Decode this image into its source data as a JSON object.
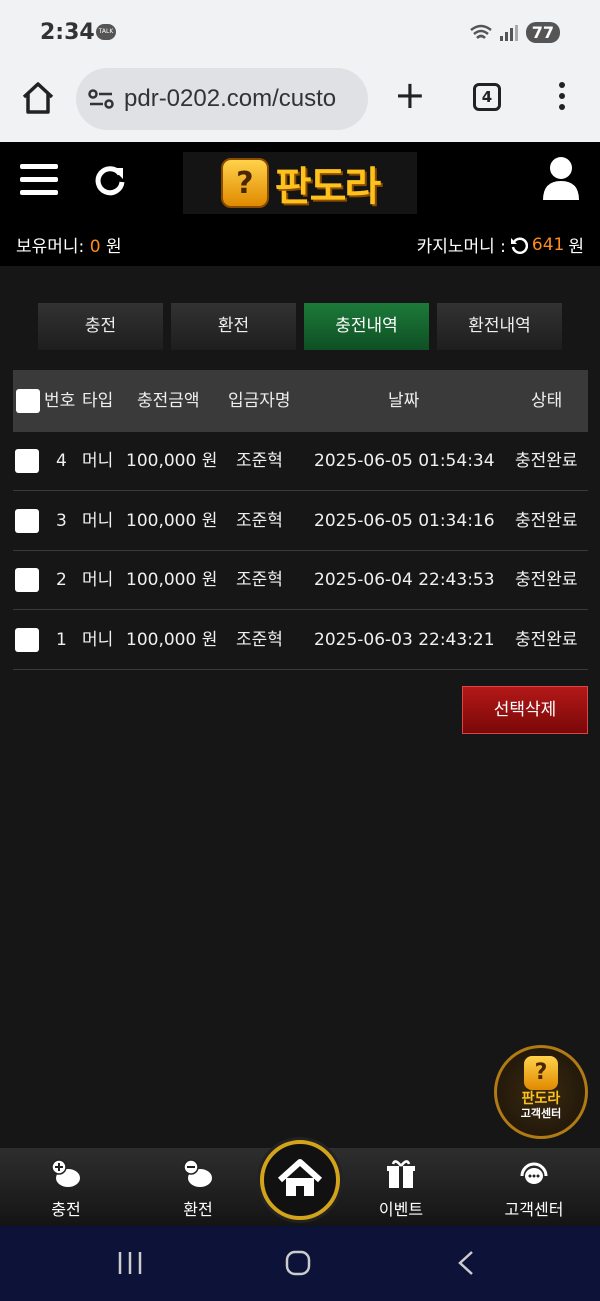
{
  "status": {
    "time": "2:34",
    "talk": "TALK",
    "battery": "77"
  },
  "browser": {
    "url": "pdr-0202.com/custo",
    "tab_count": "4"
  },
  "site": {
    "logo_badge": "?",
    "logo_text": "판도라",
    "money_label": "보유머니:",
    "money_value": "0",
    "money_unit": "원",
    "casino_label": "카지노머니 :",
    "casino_value": "641",
    "casino_unit": "원"
  },
  "tabs": [
    {
      "label": "충전",
      "active": false
    },
    {
      "label": "환전",
      "active": false
    },
    {
      "label": "충전내역",
      "active": true
    },
    {
      "label": "환전내역",
      "active": false
    }
  ],
  "table": {
    "headers": {
      "no": "번호",
      "type": "타입",
      "amount": "충전금액",
      "depositor": "입금자명",
      "date": "날짜",
      "status": "상태"
    },
    "rows": [
      {
        "no": "4",
        "type": "머니",
        "amount": "100,000 원",
        "depositor": "조준혁",
        "date": "2025-06-05 01:54:34",
        "status": "충전완료"
      },
      {
        "no": "3",
        "type": "머니",
        "amount": "100,000 원",
        "depositor": "조준혁",
        "date": "2025-06-05 01:34:16",
        "status": "충전완료"
      },
      {
        "no": "2",
        "type": "머니",
        "amount": "100,000 원",
        "depositor": "조준혁",
        "date": "2025-06-04 22:43:53",
        "status": "충전완료"
      },
      {
        "no": "1",
        "type": "머니",
        "amount": "100,000 원",
        "depositor": "조준혁",
        "date": "2025-06-03 22:43:21",
        "status": "충전완료"
      }
    ]
  },
  "delete_button": "선택삭제",
  "float_service": {
    "badge": "?",
    "line1": "판도라",
    "line2": "고객센터"
  },
  "bottom_nav": {
    "charge": "충전",
    "exchange": "환전",
    "event": "이벤트",
    "support": "고객센터"
  },
  "colors": {
    "accent_orange": "#ff8a1e",
    "active_tab": "#1c7a39",
    "delete_red": "#b31818",
    "gold": "#d3a41a"
  }
}
